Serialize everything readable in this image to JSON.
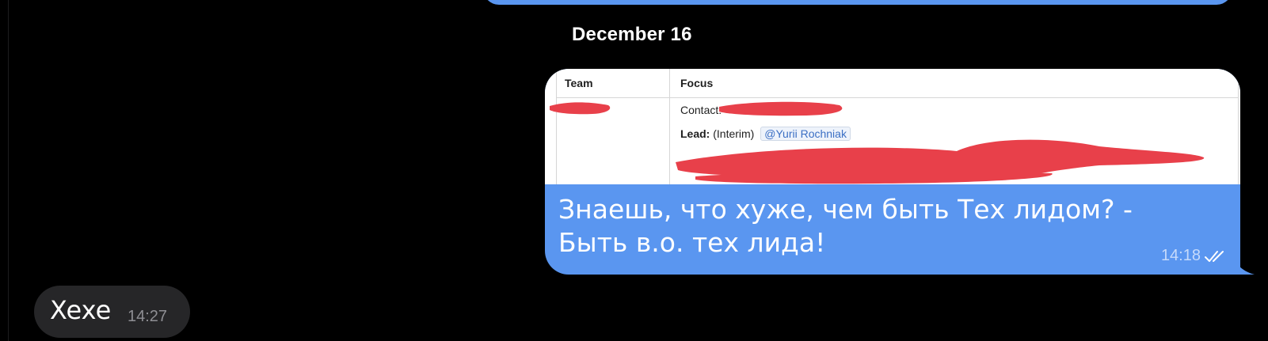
{
  "date_separator": "December 16",
  "outgoing_message": {
    "text": "Знаешь, что хуже, чем быть Тех лидом? - Быть в.о. тех лида!",
    "time": "14:18",
    "status_icon": "double-check-icon",
    "attachment": {
      "columns": [
        "Team",
        "Focus"
      ],
      "contact_label": "Contact:",
      "lead_label": "Lead:",
      "lead_value": "(Interim)",
      "lead_mention": "@Yurii Rochniak"
    }
  },
  "incoming_message": {
    "text": "Xexe",
    "time": "14:27"
  },
  "colors": {
    "background": "#000000",
    "outgoing_bubble": "#5a96f0",
    "incoming_bubble": "#262628",
    "redaction": "#e8404a"
  }
}
